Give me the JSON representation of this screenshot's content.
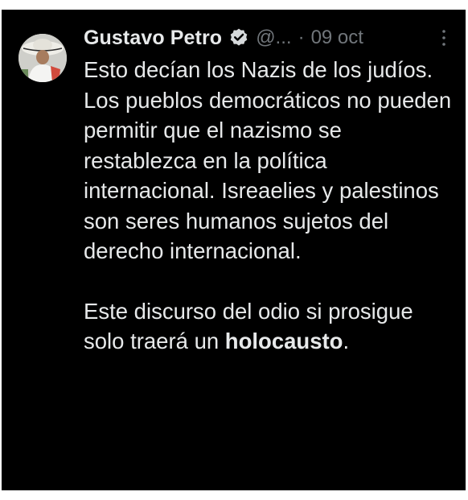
{
  "tweet": {
    "author_name": "Gustavo Petro",
    "verified_icon": "verified-badge-icon",
    "handle": "@...",
    "separator": "·",
    "date": "09 oct",
    "more_icon": "more-vertical-icon",
    "paragraph_1": "Esto decían los Nazis de los judíos. Los pueblos democráticos no pueden permitir que el nazismo se restablezca en la política internacional. Isreaelies y palestinos son seres humanos sujetos del derecho internacional.",
    "paragraph_2_text": "Este discurso del odio si prosigue solo traerá un",
    "paragraph_2_bold": "holocausto",
    "paragraph_2_end": "."
  },
  "colors": {
    "background": "#000000",
    "text_primary": "#e7e9ea",
    "text_secondary": "#71767b"
  }
}
